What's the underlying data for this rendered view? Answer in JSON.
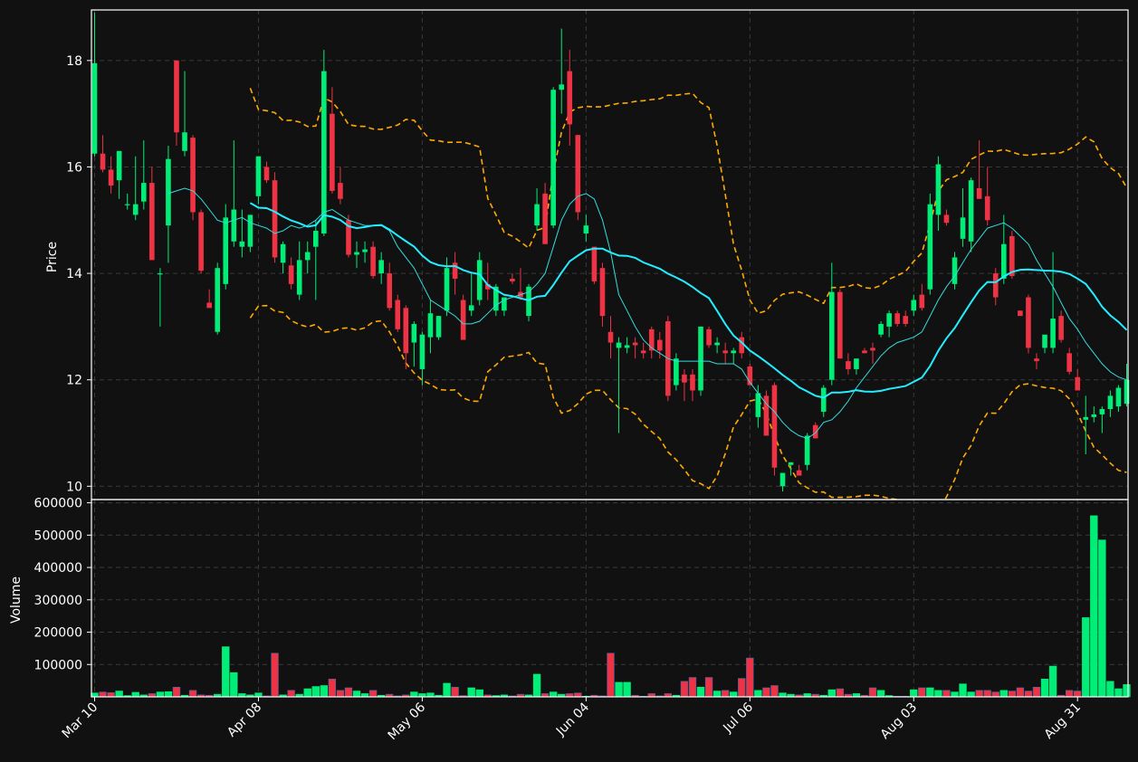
{
  "chart_data": {
    "type": "candlestick",
    "colors": {
      "background": "#111111",
      "up": "#00ee77",
      "down": "#ee3344",
      "ma_fast": "#33dddd",
      "ma_slow": "#22eeff",
      "bands": "#ffaa00",
      "grid": "#3a3a3a"
    },
    "price_panel": {
      "ylabel": "Price",
      "ylim": [
        9.75,
        18.95
      ],
      "yticks": [
        10,
        12,
        14,
        16,
        18
      ]
    },
    "volume_panel": {
      "ylabel": "Volume",
      "ylim": [
        0,
        610000
      ],
      "yticks": [
        100000,
        200000,
        300000,
        400000,
        500000,
        600000
      ]
    },
    "xticks": [
      "Mar 10",
      "Apr 08",
      "May 06",
      "Jun 04",
      "Jul 06",
      "Aug 03",
      "Aug 31"
    ],
    "xtick_index": [
      0,
      20,
      40,
      60,
      80,
      100,
      120
    ],
    "ohlc": [
      [
        16.25,
        18.9,
        16.2,
        17.95
      ],
      [
        16.25,
        16.6,
        15.9,
        15.95
      ],
      [
        15.95,
        16.2,
        15.5,
        15.65
      ],
      [
        15.75,
        16.1,
        15.4,
        16.3
      ],
      [
        15.3,
        15.5,
        15.2,
        15.3
      ],
      [
        15.1,
        16.2,
        15.0,
        15.3
      ],
      [
        15.35,
        16.5,
        15.2,
        15.7
      ],
      [
        15.7,
        16.0,
        15.1,
        14.25
      ],
      [
        14.0,
        14.1,
        13.0,
        14.0
      ],
      [
        14.9,
        16.4,
        14.2,
        16.15
      ],
      [
        18.0,
        18.0,
        16.4,
        16.65
      ],
      [
        16.3,
        17.8,
        16.2,
        16.65
      ],
      [
        16.55,
        16.6,
        15.0,
        15.15
      ],
      [
        15.15,
        15.2,
        14.0,
        14.05
      ],
      [
        13.45,
        13.7,
        13.4,
        13.35
      ],
      [
        12.9,
        14.2,
        12.85,
        14.1
      ],
      [
        13.8,
        15.3,
        13.7,
        15.05
      ],
      [
        14.6,
        16.5,
        14.5,
        15.2
      ],
      [
        14.5,
        15.2,
        14.3,
        14.6
      ],
      [
        14.5,
        15.1,
        14.4,
        15.1
      ],
      [
        15.45,
        16.2,
        15.3,
        16.2
      ],
      [
        16.0,
        16.1,
        15.7,
        15.75
      ],
      [
        15.75,
        15.9,
        14.2,
        14.3
      ],
      [
        14.2,
        14.6,
        14.0,
        14.55
      ],
      [
        14.15,
        14.3,
        13.7,
        13.8
      ],
      [
        13.6,
        14.6,
        13.5,
        14.25
      ],
      [
        14.25,
        14.6,
        14.0,
        14.4
      ],
      [
        14.5,
        15.0,
        13.5,
        14.8
      ],
      [
        14.75,
        18.2,
        14.7,
        17.8
      ],
      [
        17.0,
        17.5,
        15.5,
        15.55
      ],
      [
        15.7,
        16.0,
        15.3,
        15.4
      ],
      [
        15.0,
        15.1,
        14.3,
        14.35
      ],
      [
        14.35,
        14.6,
        14.1,
        14.4
      ],
      [
        14.4,
        14.6,
        14.2,
        14.45
      ],
      [
        14.5,
        14.6,
        13.9,
        13.95
      ],
      [
        14.0,
        14.4,
        13.8,
        14.25
      ],
      [
        14.0,
        14.2,
        13.3,
        13.35
      ],
      [
        13.5,
        13.6,
        12.9,
        12.95
      ],
      [
        13.35,
        13.4,
        12.2,
        12.5
      ],
      [
        12.7,
        13.1,
        12.25,
        13.05
      ],
      [
        12.2,
        12.9,
        11.9,
        12.85
      ],
      [
        12.8,
        13.5,
        12.5,
        13.25
      ],
      [
        12.8,
        13.2,
        12.75,
        13.2
      ],
      [
        13.3,
        14.3,
        13.2,
        14.1
      ],
      [
        14.2,
        14.4,
        13.6,
        13.9
      ],
      [
        13.5,
        13.6,
        12.8,
        12.75
      ],
      [
        13.3,
        14.0,
        13.2,
        13.4
      ],
      [
        13.5,
        14.4,
        13.4,
        14.25
      ],
      [
        13.8,
        14.2,
        13.5,
        13.7
      ],
      [
        13.3,
        13.8,
        13.2,
        13.75
      ],
      [
        13.3,
        13.5,
        13.2,
        13.55
      ],
      [
        13.9,
        14.0,
        13.8,
        13.85
      ],
      [
        13.65,
        14.1,
        13.5,
        13.55
      ],
      [
        13.2,
        13.8,
        13.1,
        13.75
      ],
      [
        14.9,
        15.6,
        14.8,
        15.3
      ],
      [
        15.5,
        15.7,
        14.6,
        14.55
      ],
      [
        14.9,
        17.5,
        14.85,
        17.45
      ],
      [
        17.45,
        18.6,
        17.0,
        17.55
      ],
      [
        17.8,
        18.2,
        16.4,
        16.8
      ],
      [
        16.6,
        16.6,
        15.0,
        15.15
      ],
      [
        14.75,
        15.1,
        14.6,
        14.9
      ],
      [
        14.5,
        14.5,
        13.8,
        13.85
      ],
      [
        14.1,
        14.2,
        13.0,
        13.2
      ],
      [
        12.9,
        13.2,
        12.4,
        12.7
      ],
      [
        12.6,
        12.8,
        11.0,
        12.7
      ],
      [
        12.6,
        12.8,
        12.5,
        12.65
      ],
      [
        12.7,
        12.8,
        12.4,
        12.65
      ],
      [
        12.55,
        12.7,
        12.4,
        12.5
      ],
      [
        12.95,
        13.0,
        12.4,
        12.55
      ],
      [
        12.75,
        12.9,
        12.4,
        12.55
      ],
      [
        13.1,
        13.2,
        11.6,
        11.7
      ],
      [
        11.9,
        12.5,
        11.8,
        12.4
      ],
      [
        12.1,
        12.2,
        11.6,
        11.95
      ],
      [
        12.1,
        12.2,
        11.6,
        11.8
      ],
      [
        11.8,
        13.0,
        11.7,
        13.0
      ],
      [
        12.95,
        13.0,
        12.6,
        12.65
      ],
      [
        12.65,
        12.8,
        12.5,
        12.7
      ],
      [
        12.55,
        12.7,
        12.3,
        12.5
      ],
      [
        12.5,
        12.6,
        12.3,
        12.55
      ],
      [
        12.8,
        12.9,
        12.4,
        12.5
      ],
      [
        12.25,
        12.3,
        11.9,
        11.9
      ],
      [
        11.3,
        11.9,
        11.1,
        11.75
      ],
      [
        11.7,
        11.8,
        11.0,
        10.95
      ],
      [
        11.9,
        11.95,
        10.2,
        10.35
      ],
      [
        10.0,
        10.2,
        9.9,
        10.25
      ],
      [
        10.4,
        10.45,
        10.2,
        10.45
      ],
      [
        10.3,
        10.4,
        10.2,
        10.2
      ],
      [
        10.4,
        11.0,
        10.3,
        10.95
      ],
      [
        11.15,
        11.2,
        10.9,
        10.9
      ],
      [
        11.4,
        11.9,
        11.3,
        11.85
      ],
      [
        12.0,
        14.2,
        11.9,
        13.65
      ],
      [
        13.65,
        13.7,
        12.4,
        12.4
      ],
      [
        12.35,
        12.5,
        12.1,
        12.2
      ],
      [
        12.2,
        12.4,
        12.1,
        12.4
      ],
      [
        12.55,
        12.6,
        12.5,
        12.5
      ],
      [
        12.6,
        12.7,
        12.3,
        12.55
      ],
      [
        12.85,
        13.1,
        12.8,
        13.05
      ],
      [
        13.0,
        13.3,
        12.8,
        13.25
      ],
      [
        13.25,
        13.3,
        13.0,
        13.05
      ],
      [
        13.2,
        13.3,
        13.0,
        13.05
      ],
      [
        13.3,
        13.6,
        13.2,
        13.5
      ],
      [
        13.6,
        13.8,
        13.3,
        13.35
      ],
      [
        13.7,
        15.5,
        13.6,
        15.3
      ],
      [
        15.1,
        16.2,
        14.8,
        16.05
      ],
      [
        15.1,
        15.2,
        14.9,
        14.95
      ],
      [
        13.8,
        14.4,
        13.7,
        14.3
      ],
      [
        14.65,
        15.6,
        14.5,
        15.05
      ],
      [
        14.6,
        15.8,
        14.4,
        15.75
      ],
      [
        15.6,
        16.5,
        15.4,
        15.4
      ],
      [
        15.45,
        16.0,
        14.9,
        15.0
      ],
      [
        14.0,
        14.1,
        13.4,
        13.55
      ],
      [
        13.9,
        15.1,
        13.8,
        14.55
      ],
      [
        14.7,
        14.8,
        13.9,
        13.95
      ],
      [
        13.3,
        13.3,
        13.2,
        13.2
      ],
      [
        13.55,
        13.6,
        12.5,
        12.6
      ],
      [
        12.4,
        12.5,
        12.2,
        12.35
      ],
      [
        12.6,
        12.8,
        12.5,
        12.85
      ],
      [
        12.6,
        14.4,
        12.5,
        13.15
      ],
      [
        13.2,
        13.3,
        12.7,
        12.75
      ],
      [
        12.5,
        12.6,
        12.1,
        12.15
      ],
      [
        12.05,
        12.2,
        11.8,
        11.8
      ],
      [
        11.25,
        11.7,
        10.6,
        11.3
      ],
      [
        11.3,
        11.5,
        11.2,
        11.35
      ],
      [
        11.35,
        11.5,
        11.0,
        11.45
      ],
      [
        11.45,
        11.8,
        11.3,
        11.7
      ],
      [
        11.5,
        11.9,
        11.4,
        11.85
      ],
      [
        11.55,
        12.3,
        11.5,
        12.0
      ]
    ],
    "volume": [
      12000,
      15000,
      13000,
      18000,
      4000,
      14000,
      6000,
      10000,
      15000,
      16000,
      30000,
      5000,
      20000,
      6000,
      5000,
      8000,
      155000,
      75000,
      10000,
      6000,
      12000,
      3000,
      135000,
      6000,
      20000,
      8000,
      25000,
      32000,
      35000,
      55000,
      20000,
      28000,
      18000,
      10000,
      20000,
      5000,
      8000,
      3000,
      6000,
      15000,
      10000,
      12000,
      5000,
      42000,
      30000,
      4000,
      28000,
      22000,
      6000,
      4000,
      6000,
      3000,
      8000,
      6000,
      70000,
      10000,
      15000,
      8000,
      10000,
      12000,
      2000,
      5000,
      3000,
      135000,
      45000,
      45000,
      5000,
      2000,
      10000,
      3000,
      10000,
      5000,
      48000,
      60000,
      30000,
      60000,
      18000,
      20000,
      15000,
      57000,
      120000,
      20000,
      28000,
      35000,
      12000,
      8000,
      6000,
      10000,
      8000,
      5000,
      22000,
      25000,
      8000,
      10000,
      5000,
      28000,
      20000,
      4000,
      2000,
      2000,
      22000,
      28000,
      28000,
      20000,
      20000,
      15000,
      40000,
      15000,
      20000,
      20000,
      15000,
      20000,
      18000,
      28000,
      18000,
      30000,
      55000,
      95000,
      5000,
      20000,
      18000,
      245000,
      560000,
      485000,
      48000,
      25000,
      38000
    ],
    "ma_fast": [
      null,
      null,
      null,
      null,
      null,
      null,
      null,
      null,
      null,
      15.5,
      15.55,
      15.6,
      15.55,
      15.4,
      15.2,
      15.0,
      14.95,
      15.0,
      15.05,
      14.95,
      14.9,
      14.85,
      14.75,
      14.8,
      14.9,
      14.85,
      14.9,
      15.0,
      15.15,
      15.2,
      15.1,
      15.0,
      14.95,
      14.9,
      14.9,
      14.9,
      14.8,
      14.5,
      14.3,
      14.1,
      13.8,
      13.5,
      13.4,
      13.3,
      13.2,
      13.05,
      13.05,
      13.1,
      13.25,
      13.4,
      13.5,
      13.55,
      13.6,
      13.65,
      13.8,
      14.0,
      14.5,
      15.0,
      15.3,
      15.45,
      15.5,
      15.4,
      15.0,
      14.4,
      13.6,
      13.3,
      13.0,
      12.75,
      12.6,
      12.5,
      12.4,
      12.35,
      12.35,
      12.35,
      12.35,
      12.35,
      12.3,
      12.3,
      12.3,
      12.2,
      11.95,
      11.75,
      11.55,
      11.4,
      11.2,
      11.05,
      10.95,
      10.9,
      11.0,
      11.2,
      11.25,
      11.4,
      11.6,
      11.85,
      12.05,
      12.25,
      12.45,
      12.6,
      12.7,
      12.75,
      12.8,
      12.9,
      13.2,
      13.5,
      13.75,
      13.95,
      14.2,
      14.45,
      14.65,
      14.85,
      14.9,
      14.95,
      14.85,
      14.7,
      14.55,
      14.25,
      14.0,
      13.75,
      13.45,
      13.15,
      12.95,
      12.7,
      12.5,
      12.3,
      12.15,
      12.05,
      12.0
    ]
  }
}
